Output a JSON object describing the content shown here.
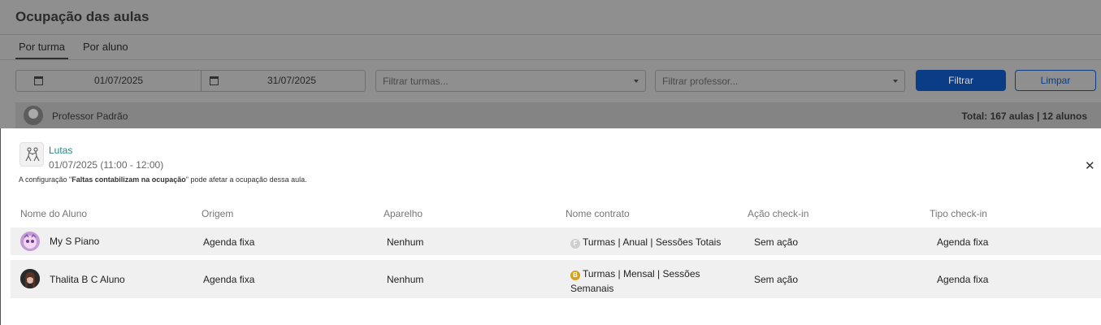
{
  "header": {
    "title": "Ocupação das aulas"
  },
  "tabs": [
    {
      "label": "Por turma"
    },
    {
      "label": "Por aluno"
    }
  ],
  "filters": {
    "date_start": "01/07/2025",
    "date_end": "31/07/2025",
    "turmas_placeholder": "Filtrar turmas...",
    "professor_placeholder": "Filtrar professor...",
    "filter_button": "Filtrar",
    "clear_button": "Limpar"
  },
  "professor": {
    "name": "Professor Padrão",
    "total": "Total: 167 aulas | 12 alunos"
  },
  "class_detail": {
    "name": "Lutas",
    "time": "01/07/2025 (11:00 - 12:00)",
    "note_prefix": "A configuração \"",
    "note_bold": "Faltas contabilizam na ocupação",
    "note_suffix": "\" pode afetar a ocupação dessa aula."
  },
  "table": {
    "headers": [
      "Nome do Aluno",
      "Origem",
      "Aparelho",
      "Nome contrato",
      "Ação check-in",
      "Tipo check-in"
    ],
    "rows": [
      {
        "name": "My S Piano",
        "origem": "Agenda fixa",
        "aparelho": "Nenhum",
        "contract_badge": "F",
        "contrato": "Turmas | Anual | Sessões Totais",
        "acao": "Sem ação",
        "tipo": "Agenda fixa"
      },
      {
        "name": "Thalita B C Aluno",
        "origem": "Agenda fixa",
        "aparelho": "Nenhum",
        "contract_badge": "B",
        "contrato_line1": "Turmas | Mensal | Sessões",
        "contrato_line2": "Semanais",
        "acao": "Sem ação",
        "tipo": "Agenda fixa"
      }
    ]
  },
  "icons": {
    "calendar": "calendar-icon",
    "caret": "caret-down-icon",
    "close": "close-icon",
    "class": "martial-arts-icon"
  },
  "colors": {
    "accent": "#1e8a82",
    "primary": "#0a3d86",
    "badge_b": "#d4a21a"
  }
}
